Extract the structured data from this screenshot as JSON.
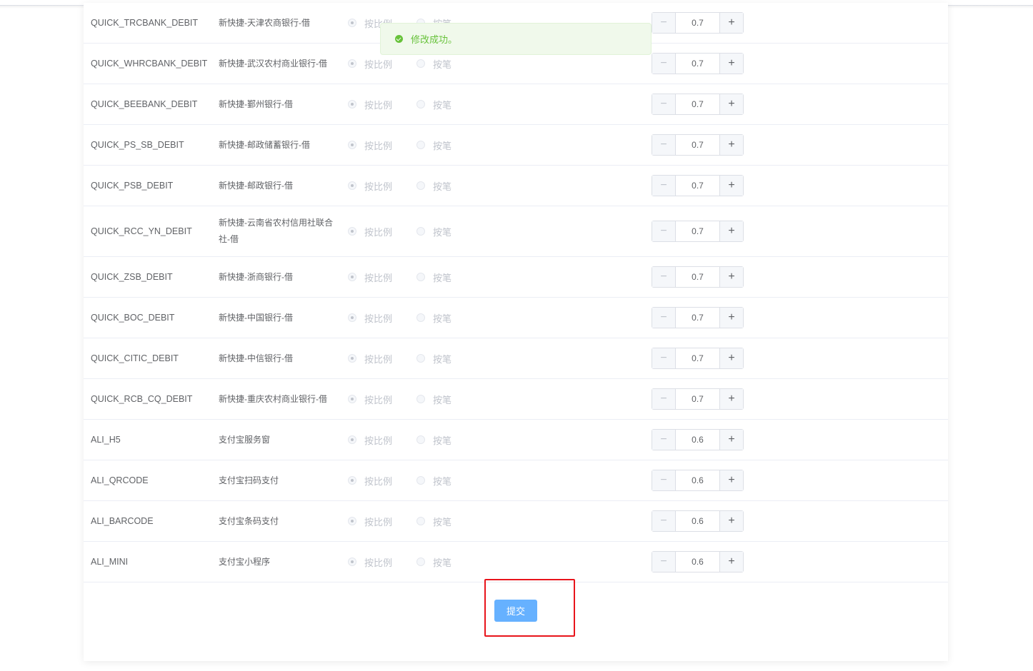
{
  "toast": {
    "message": "修改成功。",
    "icon": "success-check-icon"
  },
  "radio_labels": {
    "ratio": "按比例",
    "per_txn": "按笔"
  },
  "rows": [
    {
      "code": "QUICK_TRCBANK_DEBIT",
      "name": "新快捷-天津农商银行-借",
      "value": "0.7"
    },
    {
      "code": "QUICK_WHRCBANK_DEBIT",
      "name": "新快捷-武汉农村商业银行-借",
      "value": "0.7"
    },
    {
      "code": "QUICK_BEEBANK_DEBIT",
      "name": "新快捷-鄞州银行-借",
      "value": "0.7"
    },
    {
      "code": "QUICK_PS_SB_DEBIT",
      "name": "新快捷-邮政储蓄银行-借",
      "value": "0.7"
    },
    {
      "code": "QUICK_PSB_DEBIT",
      "name": "新快捷-邮政银行-借",
      "value": "0.7"
    },
    {
      "code": "QUICK_RCC_YN_DEBIT",
      "name": "新快捷-云南省农村信用社联合社-借",
      "value": "0.7"
    },
    {
      "code": "QUICK_ZSB_DEBIT",
      "name": "新快捷-浙商银行-借",
      "value": "0.7"
    },
    {
      "code": "QUICK_BOC_DEBIT",
      "name": "新快捷-中国银行-借",
      "value": "0.7"
    },
    {
      "code": "QUICK_CITIC_DEBIT",
      "name": "新快捷-中信银行-借",
      "value": "0.7"
    },
    {
      "code": "QUICK_RCB_CQ_DEBIT",
      "name": "新快捷-重庆农村商业银行-借",
      "value": "0.7"
    },
    {
      "code": "ALI_H5",
      "name": "支付宝服务窗",
      "value": "0.6"
    },
    {
      "code": "ALI_QRCODE",
      "name": "支付宝扫码支付",
      "value": "0.6"
    },
    {
      "code": "ALI_BARCODE",
      "name": "支付宝条码支付",
      "value": "0.6"
    },
    {
      "code": "ALI_MINI",
      "name": "支付宝小程序",
      "value": "0.6"
    }
  ],
  "stepper": {
    "minus": "−",
    "plus": "+"
  },
  "submit_label": "提交"
}
